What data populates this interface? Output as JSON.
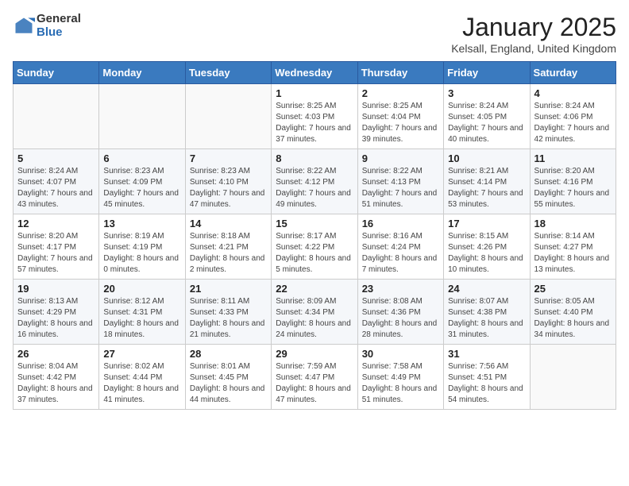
{
  "logo": {
    "general": "General",
    "blue": "Blue"
  },
  "title": "January 2025",
  "subtitle": "Kelsall, England, United Kingdom",
  "days_of_week": [
    "Sunday",
    "Monday",
    "Tuesday",
    "Wednesday",
    "Thursday",
    "Friday",
    "Saturday"
  ],
  "weeks": [
    [
      {
        "day": "",
        "info": ""
      },
      {
        "day": "",
        "info": ""
      },
      {
        "day": "",
        "info": ""
      },
      {
        "day": "1",
        "info": "Sunrise: 8:25 AM\nSunset: 4:03 PM\nDaylight: 7 hours\nand 37 minutes."
      },
      {
        "day": "2",
        "info": "Sunrise: 8:25 AM\nSunset: 4:04 PM\nDaylight: 7 hours\nand 39 minutes."
      },
      {
        "day": "3",
        "info": "Sunrise: 8:24 AM\nSunset: 4:05 PM\nDaylight: 7 hours\nand 40 minutes."
      },
      {
        "day": "4",
        "info": "Sunrise: 8:24 AM\nSunset: 4:06 PM\nDaylight: 7 hours\nand 42 minutes."
      }
    ],
    [
      {
        "day": "5",
        "info": "Sunrise: 8:24 AM\nSunset: 4:07 PM\nDaylight: 7 hours\nand 43 minutes."
      },
      {
        "day": "6",
        "info": "Sunrise: 8:23 AM\nSunset: 4:09 PM\nDaylight: 7 hours\nand 45 minutes."
      },
      {
        "day": "7",
        "info": "Sunrise: 8:23 AM\nSunset: 4:10 PM\nDaylight: 7 hours\nand 47 minutes."
      },
      {
        "day": "8",
        "info": "Sunrise: 8:22 AM\nSunset: 4:12 PM\nDaylight: 7 hours\nand 49 minutes."
      },
      {
        "day": "9",
        "info": "Sunrise: 8:22 AM\nSunset: 4:13 PM\nDaylight: 7 hours\nand 51 minutes."
      },
      {
        "day": "10",
        "info": "Sunrise: 8:21 AM\nSunset: 4:14 PM\nDaylight: 7 hours\nand 53 minutes."
      },
      {
        "day": "11",
        "info": "Sunrise: 8:20 AM\nSunset: 4:16 PM\nDaylight: 7 hours\nand 55 minutes."
      }
    ],
    [
      {
        "day": "12",
        "info": "Sunrise: 8:20 AM\nSunset: 4:17 PM\nDaylight: 7 hours\nand 57 minutes."
      },
      {
        "day": "13",
        "info": "Sunrise: 8:19 AM\nSunset: 4:19 PM\nDaylight: 8 hours\nand 0 minutes."
      },
      {
        "day": "14",
        "info": "Sunrise: 8:18 AM\nSunset: 4:21 PM\nDaylight: 8 hours\nand 2 minutes."
      },
      {
        "day": "15",
        "info": "Sunrise: 8:17 AM\nSunset: 4:22 PM\nDaylight: 8 hours\nand 5 minutes."
      },
      {
        "day": "16",
        "info": "Sunrise: 8:16 AM\nSunset: 4:24 PM\nDaylight: 8 hours\nand 7 minutes."
      },
      {
        "day": "17",
        "info": "Sunrise: 8:15 AM\nSunset: 4:26 PM\nDaylight: 8 hours\nand 10 minutes."
      },
      {
        "day": "18",
        "info": "Sunrise: 8:14 AM\nSunset: 4:27 PM\nDaylight: 8 hours\nand 13 minutes."
      }
    ],
    [
      {
        "day": "19",
        "info": "Sunrise: 8:13 AM\nSunset: 4:29 PM\nDaylight: 8 hours\nand 16 minutes."
      },
      {
        "day": "20",
        "info": "Sunrise: 8:12 AM\nSunset: 4:31 PM\nDaylight: 8 hours\nand 18 minutes."
      },
      {
        "day": "21",
        "info": "Sunrise: 8:11 AM\nSunset: 4:33 PM\nDaylight: 8 hours\nand 21 minutes."
      },
      {
        "day": "22",
        "info": "Sunrise: 8:09 AM\nSunset: 4:34 PM\nDaylight: 8 hours\nand 24 minutes."
      },
      {
        "day": "23",
        "info": "Sunrise: 8:08 AM\nSunset: 4:36 PM\nDaylight: 8 hours\nand 28 minutes."
      },
      {
        "day": "24",
        "info": "Sunrise: 8:07 AM\nSunset: 4:38 PM\nDaylight: 8 hours\nand 31 minutes."
      },
      {
        "day": "25",
        "info": "Sunrise: 8:05 AM\nSunset: 4:40 PM\nDaylight: 8 hours\nand 34 minutes."
      }
    ],
    [
      {
        "day": "26",
        "info": "Sunrise: 8:04 AM\nSunset: 4:42 PM\nDaylight: 8 hours\nand 37 minutes."
      },
      {
        "day": "27",
        "info": "Sunrise: 8:02 AM\nSunset: 4:44 PM\nDaylight: 8 hours\nand 41 minutes."
      },
      {
        "day": "28",
        "info": "Sunrise: 8:01 AM\nSunset: 4:45 PM\nDaylight: 8 hours\nand 44 minutes."
      },
      {
        "day": "29",
        "info": "Sunrise: 7:59 AM\nSunset: 4:47 PM\nDaylight: 8 hours\nand 47 minutes."
      },
      {
        "day": "30",
        "info": "Sunrise: 7:58 AM\nSunset: 4:49 PM\nDaylight: 8 hours\nand 51 minutes."
      },
      {
        "day": "31",
        "info": "Sunrise: 7:56 AM\nSunset: 4:51 PM\nDaylight: 8 hours\nand 54 minutes."
      },
      {
        "day": "",
        "info": ""
      }
    ]
  ]
}
